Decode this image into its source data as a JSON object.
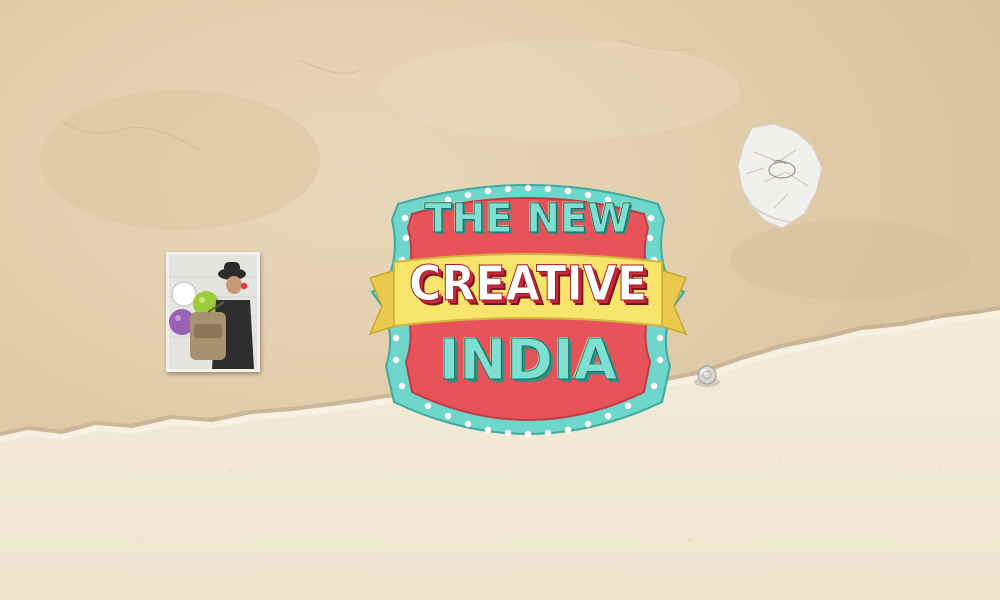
{
  "logo": {
    "line_1": "THE NEW",
    "line_2": "CREATIVE",
    "line_3": "INDIA"
  },
  "colors": {
    "badge_red": "#e8535a",
    "badge_teal": "#6fd6cb",
    "banner_yellow": "#f7e46a",
    "paper_tan": "#e3cfb0",
    "paper_cream": "#f1e8d6"
  },
  "icons": {
    "photo": "pinned-photo-icon",
    "paper": "crumpled-paper-icon",
    "pin": "thumbtack-icon"
  }
}
